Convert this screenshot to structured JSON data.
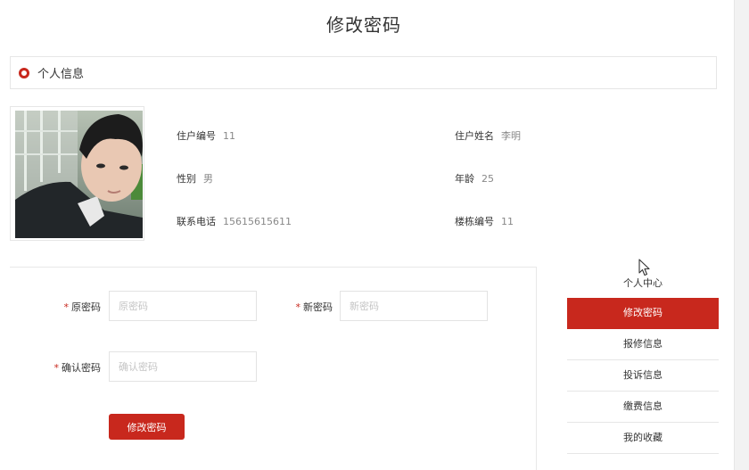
{
  "page": {
    "title": "修改密码"
  },
  "section": {
    "title": "个人信息"
  },
  "profile": {
    "fields": [
      {
        "label": "住户编号",
        "value": "11"
      },
      {
        "label": "住户姓名",
        "value": "李明"
      },
      {
        "label": "性别",
        "value": "男"
      },
      {
        "label": "年龄",
        "value": "25"
      },
      {
        "label": "联系电话",
        "value": "15615615611"
      },
      {
        "label": "楼栋编号",
        "value": "11"
      }
    ]
  },
  "form": {
    "required_mark": "*",
    "old_password": {
      "label": "原密码",
      "placeholder": "原密码",
      "value": ""
    },
    "new_password": {
      "label": "新密码",
      "placeholder": "新密码",
      "value": ""
    },
    "confirm_password": {
      "label": "确认密码",
      "placeholder": "确认密码",
      "value": ""
    },
    "submit_label": "修改密码"
  },
  "sidebar": {
    "title": "个人中心",
    "items": [
      {
        "label": "修改密码",
        "active": true
      },
      {
        "label": "报修信息",
        "active": false
      },
      {
        "label": "投诉信息",
        "active": false
      },
      {
        "label": "缴费信息",
        "active": false
      },
      {
        "label": "我的收藏",
        "active": false
      }
    ]
  },
  "colors": {
    "accent": "#c8281d",
    "border": "#e6e6e6",
    "placeholder": "#c4c4c4"
  },
  "icons": {
    "section_marker": "ring-icon",
    "pointer": "mouse-pointer-icon"
  }
}
